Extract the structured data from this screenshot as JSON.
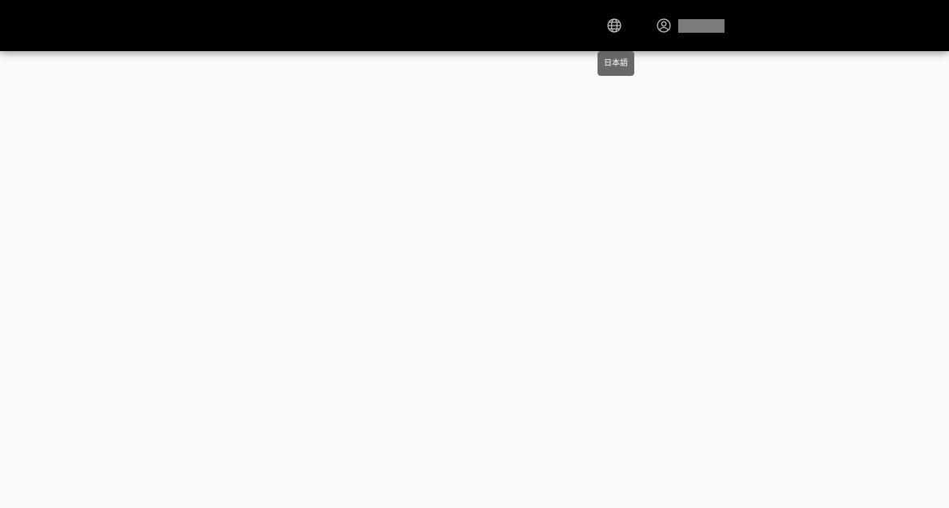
{
  "colors": {
    "topbar_bg": "#000000",
    "page_bg": "#fafafa",
    "icon_color": "#bdbdbd",
    "tooltip_bg": "#616161",
    "tooltip_text": "#ffffff",
    "redaction": "#7b7b7b"
  },
  "header": {
    "language_button": {
      "icon": "globe-icon",
      "tooltip": "日本語"
    },
    "account_button": {
      "icon": "account-circle-icon",
      "name": ""
    }
  }
}
